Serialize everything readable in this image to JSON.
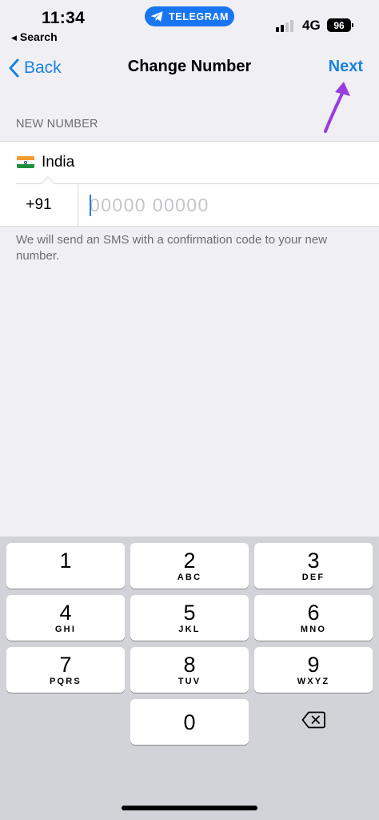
{
  "status_bar": {
    "time": "11:34",
    "back_app": "Search",
    "app_pill": "TELEGRAM",
    "network": "4G",
    "battery": "96"
  },
  "nav": {
    "back_label": "Back",
    "title": "Change Number",
    "next_label": "Next"
  },
  "form": {
    "section_header": "NEW NUMBER",
    "country": "India",
    "country_code": "+91",
    "phone_value": "",
    "phone_placeholder": "00000 00000",
    "hint": "We will send an SMS with a confirmation code to your new number."
  },
  "keypad": {
    "keys": [
      {
        "digit": "1",
        "letters": ""
      },
      {
        "digit": "2",
        "letters": "ABC"
      },
      {
        "digit": "3",
        "letters": "DEF"
      },
      {
        "digit": "4",
        "letters": "GHI"
      },
      {
        "digit": "5",
        "letters": "JKL"
      },
      {
        "digit": "6",
        "letters": "MNO"
      },
      {
        "digit": "7",
        "letters": "PQRS"
      },
      {
        "digit": "8",
        "letters": "TUV"
      },
      {
        "digit": "9",
        "letters": "WXYZ"
      },
      {
        "digit": "0",
        "letters": ""
      }
    ]
  },
  "colors": {
    "accent": "#1b82e0",
    "pill": "#1976f2",
    "annotation_arrow": "#9a3be0",
    "background": "#efeff4",
    "keypad_background": "#d1d3d9"
  },
  "icons": {
    "back": "chevron-left-icon",
    "pill": "telegram-plane-icon",
    "delete": "backspace-icon",
    "flag": "india-flag-icon"
  }
}
